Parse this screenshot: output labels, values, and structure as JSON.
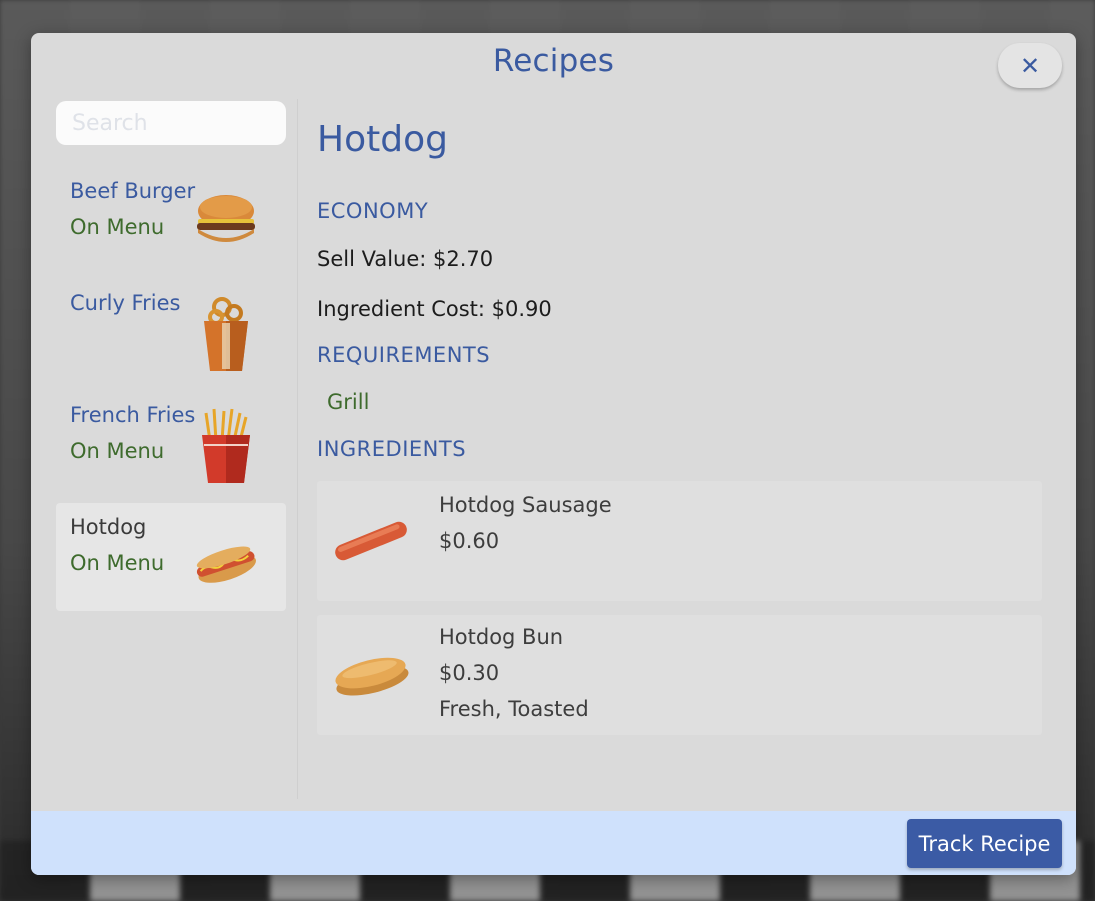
{
  "modal": {
    "title": "Recipes",
    "close_icon": "close-icon"
  },
  "sidebar": {
    "search_placeholder": "Search",
    "search_value": "",
    "items": [
      {
        "name": "Beef Burger",
        "status": "On Menu",
        "icon": "burger-icon",
        "selected": false
      },
      {
        "name": "Curly Fries",
        "status": "",
        "icon": "curly-fries-icon",
        "selected": false
      },
      {
        "name": "French Fries",
        "status": "On Menu",
        "icon": "french-fries-icon",
        "selected": false
      },
      {
        "name": "Hotdog",
        "status": "On Menu",
        "icon": "hotdog-icon",
        "selected": true
      }
    ]
  },
  "detail": {
    "title": "Hotdog",
    "economy_heading": "ECONOMY",
    "sell_value": "Sell Value: $2.70",
    "ingredient_cost": "Ingredient Cost: $0.90",
    "requirements_heading": "REQUIREMENTS",
    "requirements": [
      "Grill"
    ],
    "ingredients_heading": "INGREDIENTS",
    "ingredients": [
      {
        "name": "Hotdog Sausage",
        "price": "$0.60",
        "extra": "",
        "icon": "sausage-icon"
      },
      {
        "name": "Hotdog Bun",
        "price": "$0.30",
        "extra": "Fresh, Toasted",
        "icon": "bun-icon"
      }
    ]
  },
  "footer": {
    "track_label": "Track Recipe"
  },
  "colors": {
    "accent": "#3a5aa0",
    "on_menu": "#3e6b2d",
    "panel": "#dadada",
    "footer": "#cfe1fc",
    "button": "#3b5ba5"
  }
}
